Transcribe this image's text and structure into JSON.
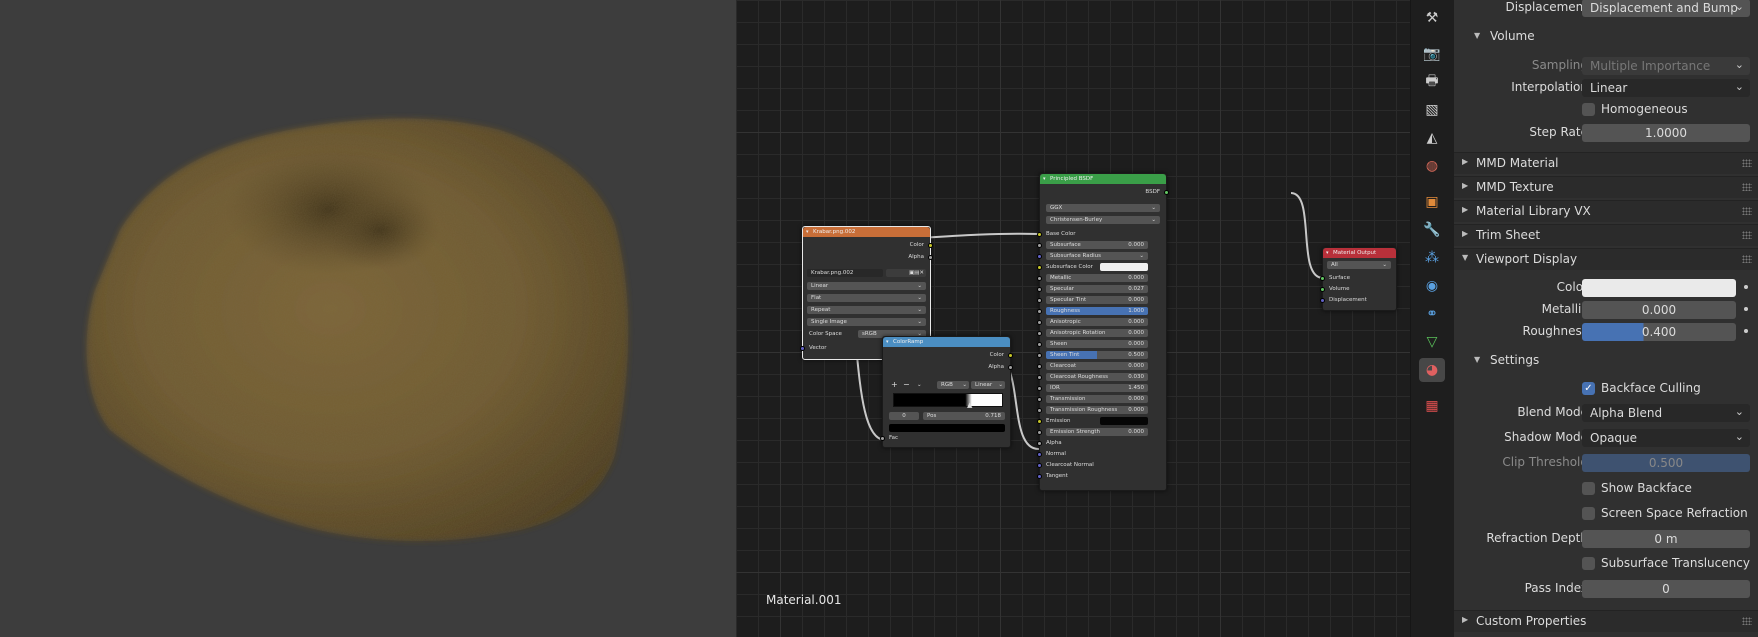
{
  "editor": {
    "material_name": "Material.001"
  },
  "colors": {
    "accent": "#4772b3",
    "node_texture": "#c86e38",
    "node_shader": "#3a9e48",
    "node_converter": "#4b8ec2",
    "node_output": "#b8303a",
    "socket_yellow": "#c7c729",
    "socket_grey": "#a1a1a1",
    "socket_purple": "#6363c7",
    "socket_green": "#63c763"
  },
  "image_node": {
    "title": "Krabar.png.002",
    "out_color": "Color",
    "out_alpha": "Alpha",
    "image": "Krabar.png.002",
    "interp": "Linear",
    "projection": "Flat",
    "extension": "Repeat",
    "source": "Single Image",
    "color_space_label": "Color Space",
    "color_space": "sRGB",
    "in_vector": "Vector"
  },
  "ramp_node": {
    "title": "ColorRamp",
    "out_color": "Color",
    "out_alpha": "Alpha",
    "plus": "+",
    "minus": "−",
    "mode": "RGB",
    "interp": "Linear",
    "index": "0",
    "pos_label": "Pos",
    "pos": "0.718",
    "in_fac": "Fac"
  },
  "bsdf_node": {
    "title": "Principled BSDF",
    "out": "BSDF",
    "distribution": "GGX",
    "subsurface_method": "Christensen-Burley",
    "rows": [
      {
        "name": "Base Color",
        "kind": "label",
        "sock": "yellow"
      },
      {
        "name": "Subsurface",
        "kind": "field",
        "value": "0.000",
        "sock": "grey"
      },
      {
        "name": "Subsurface Radius",
        "kind": "drop",
        "value": "",
        "sock": "purple"
      },
      {
        "name": "Subsurface Color",
        "kind": "color",
        "value": "",
        "sock": "yellow"
      },
      {
        "name": "Metallic",
        "kind": "field",
        "value": "0.000",
        "sock": "grey"
      },
      {
        "name": "Specular",
        "kind": "field",
        "value": "0.027",
        "sock": "grey"
      },
      {
        "name": "Specular Tint",
        "kind": "field",
        "value": "0.000",
        "sock": "grey"
      },
      {
        "name": "Roughness",
        "kind": "fill",
        "value": "1.000",
        "sock": "grey",
        "fill": 1.0
      },
      {
        "name": "Anisotropic",
        "kind": "field",
        "value": "0.000",
        "sock": "grey"
      },
      {
        "name": "Anisotropic Rotation",
        "kind": "field",
        "value": "0.000",
        "sock": "grey"
      },
      {
        "name": "Sheen",
        "kind": "field",
        "value": "0.000",
        "sock": "grey"
      },
      {
        "name": "Sheen Tint",
        "kind": "fill",
        "value": "0.500",
        "sock": "grey",
        "fill": 0.5
      },
      {
        "name": "Clearcoat",
        "kind": "field",
        "value": "0.000",
        "sock": "grey"
      },
      {
        "name": "Clearcoat Roughness",
        "kind": "field",
        "value": "0.030",
        "sock": "grey"
      },
      {
        "name": "IOR",
        "kind": "field",
        "value": "1.450",
        "sock": "grey"
      },
      {
        "name": "Transmission",
        "kind": "field",
        "value": "0.000",
        "sock": "grey"
      },
      {
        "name": "Transmission Roughness",
        "kind": "field",
        "value": "0.000",
        "sock": "grey"
      },
      {
        "name": "Emission",
        "kind": "darkcolor",
        "value": "",
        "sock": "yellow"
      },
      {
        "name": "Emission Strength",
        "kind": "field",
        "value": "0.000",
        "sock": "grey"
      },
      {
        "name": "Alpha",
        "kind": "label",
        "sock": "grey"
      },
      {
        "name": "Normal",
        "kind": "label",
        "sock": "purple"
      },
      {
        "name": "Clearcoat Normal",
        "kind": "label",
        "sock": "purple"
      },
      {
        "name": "Tangent",
        "kind": "label",
        "sock": "purple"
      }
    ]
  },
  "output_node": {
    "title": "Material Output",
    "target": "All",
    "surface": "Surface",
    "volume": "Volume",
    "displacement": "Displacement"
  },
  "props": {
    "displacement_label": "Displacement",
    "displacement_value": "Displacement and Bump",
    "volume_title": "Volume",
    "sampling_label": "Sampling",
    "sampling_value": "Multiple Importance",
    "interpolation_label": "Interpolation",
    "interpolation_value": "Linear",
    "homogeneous": "Homogeneous",
    "step_rate_label": "Step Rate",
    "step_rate_value": "1.0000",
    "panels": [
      "MMD Material",
      "MMD Texture",
      "Material Library VX",
      "Trim Sheet"
    ],
    "viewport_display": "Viewport Display",
    "color_label": "Color",
    "metallic_label": "Metallic",
    "metallic_value": "0.000",
    "roughness_label": "Roughness",
    "roughness_value": "0.400",
    "roughness_fill": 0.4,
    "settings_title": "Settings",
    "backface_culling": "Backface Culling",
    "blend_mode_label": "Blend Mode",
    "blend_mode_value": "Alpha Blend",
    "shadow_mode_label": "Shadow Mode",
    "shadow_mode_value": "Opaque",
    "clip_threshold_label": "Clip Threshold",
    "clip_threshold_value": "0.500",
    "show_backface": "Show Backface",
    "ssr": "Screen Space Refraction",
    "refraction_depth_label": "Refraction Depth",
    "refraction_depth_value": "0 m",
    "sss_translucency": "Subsurface Translucency",
    "pass_index_label": "Pass Index",
    "pass_index_value": "0",
    "custom_properties": "Custom Properties"
  },
  "tab_icons": [
    "tool-icon",
    "render-icon",
    "output-icon",
    "view-layer-icon",
    "scene-icon",
    "world-icon",
    "object-icon",
    "modifier-icon",
    "particles-icon",
    "physics-icon",
    "constraints-icon",
    "data-icon",
    "material-icon",
    "texture-icon"
  ]
}
